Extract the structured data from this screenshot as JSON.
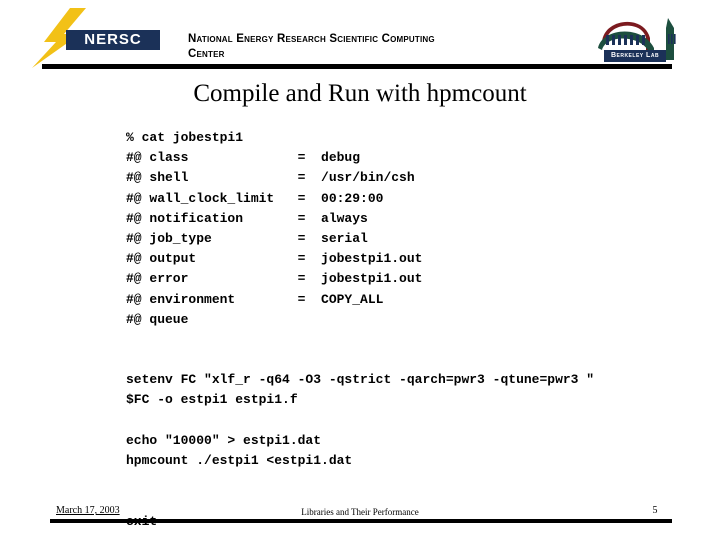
{
  "slide": {
    "title": "Compile and Run with hpmcount",
    "background_color": "#ffffff"
  },
  "header": {
    "nersc_logo": {
      "wordmark": "NERSC",
      "bolt_color": "#f2c117",
      "box_color": "#1b3158",
      "text_color": "#ffffff"
    },
    "organization_line1": "National Energy Research Scientific Computing",
    "organization_line2": "Center",
    "berkeley_logo": {
      "wordmark": "Berkeley Lab",
      "dome_color": "#7b1a1f",
      "arc_color": "#1d4f3f",
      "box_color": "#1b3158"
    },
    "rule_color": "#000000"
  },
  "code": {
    "lines": [
      "% cat jobestpi1",
      "#@ class              =  debug",
      "#@ shell              =  /usr/bin/csh",
      "#@ wall_clock_limit   =  00:29:00",
      "#@ notification       =  always",
      "#@ job_type           =  serial",
      "#@ output             =  jobestpi1.out",
      "#@ error              =  jobestpi1.out",
      "#@ environment        =  COPY_ALL",
      "#@ queue",
      "",
      "",
      "setenv FC \"xlf_r -q64 -O3 -qstrict -qarch=pwr3 -qtune=pwr3 \"",
      "$FC -o estpi1 estpi1.f",
      "",
      "echo \"10000\" > estpi1.dat",
      "hpmcount ./estpi1 <estpi1.dat",
      "",
      "",
      "exit"
    ]
  },
  "footer": {
    "date": "March 17, 2003",
    "center_text": "Libraries and Their Performance",
    "page_number": "5",
    "rule_color": "#000000"
  }
}
